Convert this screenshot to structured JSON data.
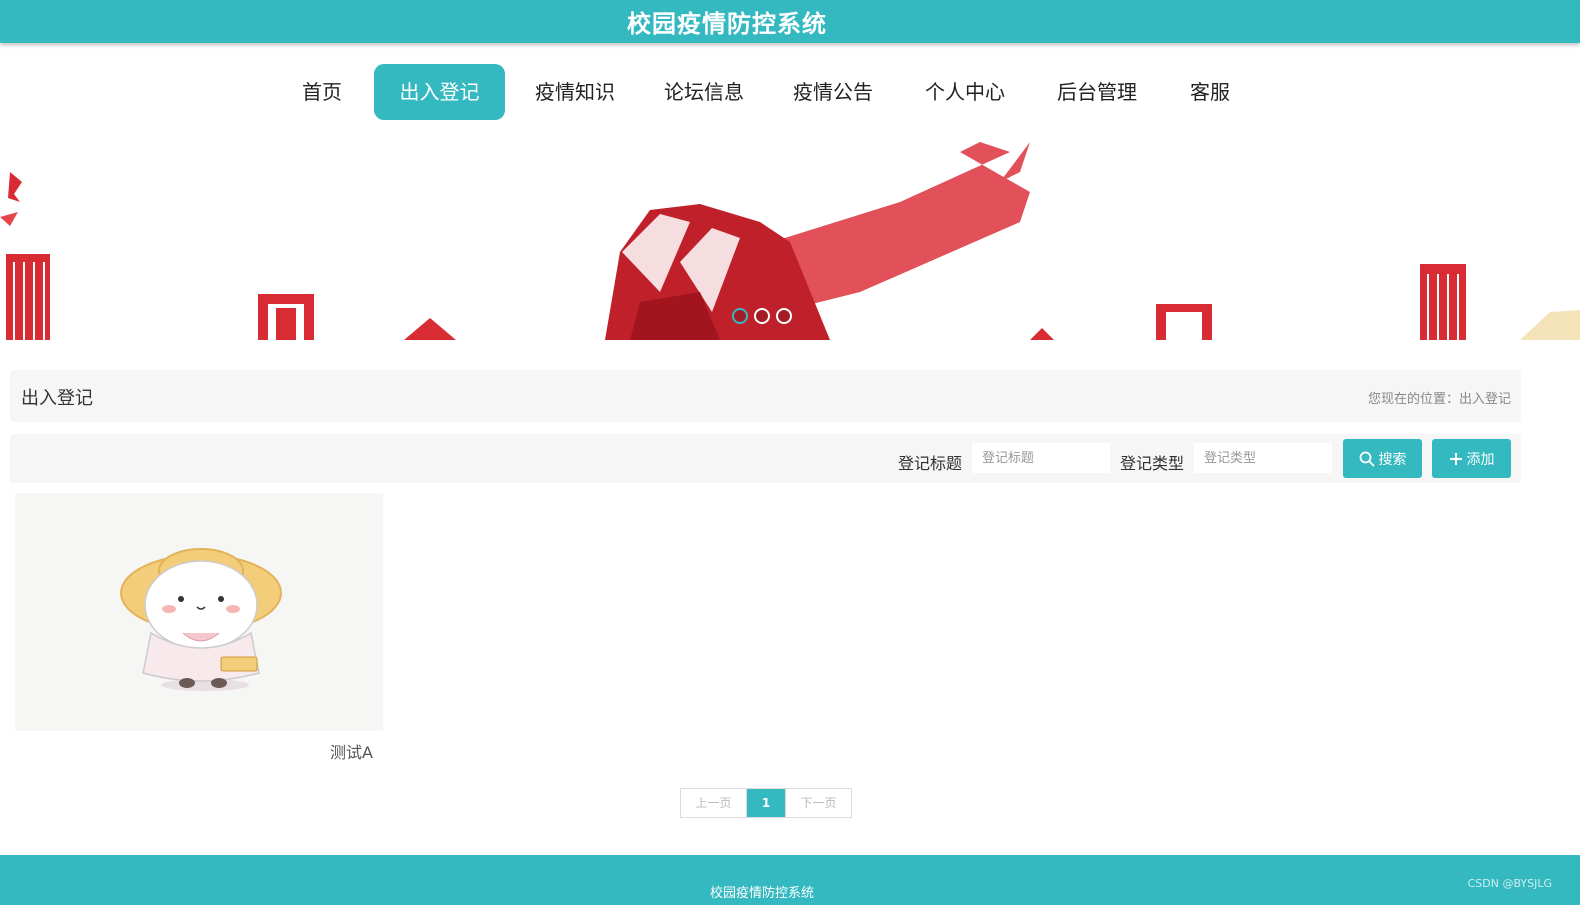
{
  "header": {
    "title": "校园疫情防控系统"
  },
  "nav": {
    "items": [
      "首页",
      "出入登记",
      "疫情知识",
      "论坛信息",
      "疫情公告",
      "个人中心",
      "后台管理",
      "客服"
    ],
    "active_index": 1
  },
  "banner": {
    "slide_count": 3,
    "active_slide": 0
  },
  "section": {
    "title": "出入登记",
    "breadcrumb": "您现在的位置：出入登记"
  },
  "search": {
    "title_label": "登记标题",
    "title_placeholder": "登记标题",
    "type_label": "登记类型",
    "type_placeholder": "登记类型",
    "search_button": "搜索",
    "add_button": "添加"
  },
  "records": [
    {
      "caption": "测试A"
    }
  ],
  "pagination": {
    "prev": "上一页",
    "current": "1",
    "next": "下一页"
  },
  "footer": {
    "text": "校园疫情防控系统",
    "watermark": "CSDN @BYSJLG"
  },
  "colors": {
    "accent": "#34b9c1",
    "banner_red": "#d92b33"
  }
}
